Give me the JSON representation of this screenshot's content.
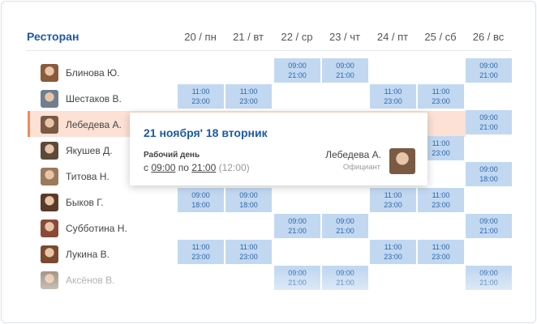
{
  "header": {
    "title": "Ресторан"
  },
  "days": [
    "20 / пн",
    "21 / вт",
    "22 / ср",
    "23 / чт",
    "24 / пт",
    "25 / сб",
    "26 / вс"
  ],
  "employees": [
    {
      "name": "Блинова Ю.",
      "avatar_color": "#8a5a3c",
      "shifts": [
        null,
        null,
        "09:00|21:00",
        "09:00|21:00",
        null,
        null,
        "09:00|21:00"
      ]
    },
    {
      "name": "Шестаков В.",
      "avatar_color": "#6f7f8f",
      "shifts": [
        "11:00|23:00",
        "11:00|23:00",
        null,
        null,
        "11:00|23:00",
        "11:00|23:00",
        null
      ]
    },
    {
      "name": "Лебедева А.",
      "avatar_color": "#7a5a43",
      "selected": true,
      "shifts": [
        null,
        null,
        null,
        null,
        null,
        null,
        "09:00|21:00"
      ]
    },
    {
      "name": "Якушев Д.",
      "avatar_color": "#5b4a3a",
      "shifts": [
        null,
        null,
        null,
        null,
        null,
        "11:00|23:00",
        null
      ]
    },
    {
      "name": "Титова Н.",
      "avatar_color": "#9a7a5a",
      "shifts": [
        null,
        null,
        null,
        null,
        null,
        null,
        "09:00|18:00"
      ]
    },
    {
      "name": "Быков Г.",
      "avatar_color": "#5a3a28",
      "shifts": [
        "09:00|18:00",
        "09:00|18:00",
        null,
        null,
        "11:00|23:00",
        "11:00|23:00",
        null
      ]
    },
    {
      "name": "Субботина Н.",
      "avatar_color": "#8a4a3a",
      "shifts": [
        null,
        null,
        "09:00|21:00",
        "09:00|21:00",
        null,
        null,
        "09:00|21:00"
      ]
    },
    {
      "name": "Лукина В.",
      "avatar_color": "#7a4a30",
      "shifts": [
        "11:00|23:00",
        "11:00|23:00",
        null,
        null,
        "11:00|23:00",
        "11:00|23:00",
        null
      ]
    },
    {
      "name": "Аксёнов В.",
      "avatar_color": "#a09080",
      "shifts": [
        null,
        null,
        "09:00|21:00",
        "09:00|21:00",
        null,
        null,
        "09:00|21:00"
      ]
    }
  ],
  "popup": {
    "title": "21 ноября' 18 вторник",
    "label": "Рабочий день",
    "from_word": "с",
    "from_time": "09:00",
    "to_word": "по",
    "to_time": "21:00",
    "duration": "(12:00)",
    "employee": "Лебедева А.",
    "role": "Официант"
  },
  "colors": {
    "accent": "#1d5aa6",
    "shift_bg": "#c2d8f1",
    "selected_bg": "#fde1d5",
    "selected_marker": "#f08a5d"
  }
}
